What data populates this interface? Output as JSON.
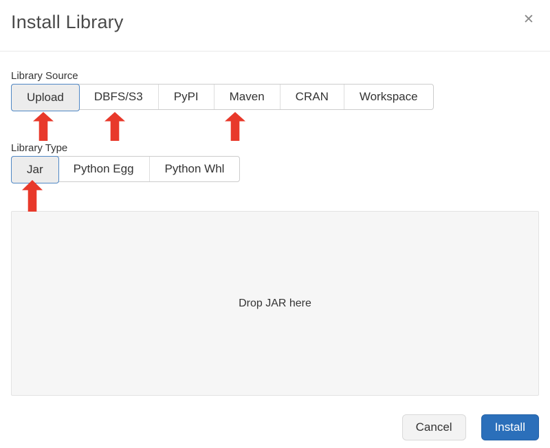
{
  "dialog": {
    "title": "Install Library",
    "close_icon": "✕"
  },
  "library_source": {
    "label": "Library Source",
    "options": [
      {
        "label": "Upload",
        "selected": true
      },
      {
        "label": "DBFS/S3",
        "selected": false
      },
      {
        "label": "PyPI",
        "selected": false
      },
      {
        "label": "Maven",
        "selected": false
      },
      {
        "label": "CRAN",
        "selected": false
      },
      {
        "label": "Workspace",
        "selected": false
      }
    ]
  },
  "library_type": {
    "label": "Library Type",
    "options": [
      {
        "label": "Jar",
        "selected": true
      },
      {
        "label": "Python Egg",
        "selected": false
      },
      {
        "label": "Python Whl",
        "selected": false
      }
    ]
  },
  "dropzone": {
    "text": "Drop JAR here"
  },
  "footer": {
    "cancel_label": "Cancel",
    "install_label": "Install"
  },
  "annotations": {
    "arrow_color": "#e8392b",
    "arrows_pointing_at": [
      "Upload",
      "DBFS/S3",
      "Maven",
      "Jar"
    ]
  },
  "colors": {
    "accent_blue": "#2b6fba",
    "selected_border": "#4e86c4",
    "selected_bg": "#ececec",
    "dropzone_bg": "#f6f6f6",
    "arrow_red": "#e8392b"
  }
}
